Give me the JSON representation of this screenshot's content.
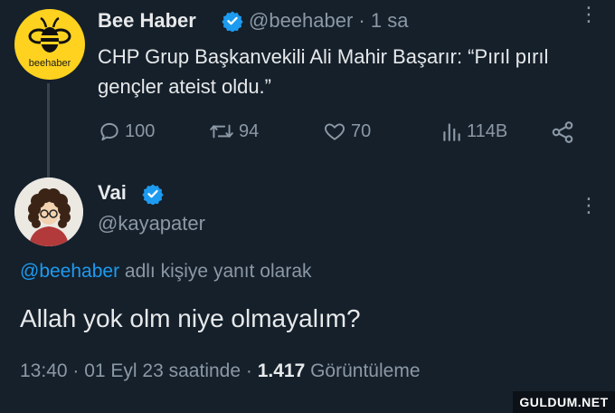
{
  "tweet": {
    "author_name": "Bee Haber",
    "author_handle": "@beehaber",
    "time_sep": " · ",
    "time": "1 sa",
    "avatar_logo_text": "beehaber",
    "text": "CHP Grup Başkanvekili Ali Mahir Başarır: “Pırıl pırıl gençler ateist oldu.”",
    "actions": {
      "reply_count": "100",
      "retweet_count": "94",
      "like_count": "70",
      "view_count": "114B"
    }
  },
  "reply": {
    "author_name": "Vai",
    "author_handle": "@kayapater",
    "replying_to_handle": "@beehaber",
    "replying_to_suffix": " adlı kişiye yanıt olarak",
    "text": "Allah yok olm niye olmayalım?",
    "meta": {
      "time": "13:40",
      "sep1": " · ",
      "date": "01 Eyl 23 saatinde",
      "sep2": " · ",
      "views": "1.417",
      "views_label": " Görüntüleme"
    }
  },
  "watermark": "GULDUM.NET",
  "colors": {
    "background": "#15202b",
    "text": "#e7e9ea",
    "muted": "#8b98a5",
    "accent": "#1d9bf0",
    "brand_yellow": "#ffd21f"
  },
  "icons": [
    "verified-badge-icon",
    "more-icon",
    "reply-icon",
    "retweet-icon",
    "like-icon",
    "views-icon",
    "share-icon"
  ]
}
